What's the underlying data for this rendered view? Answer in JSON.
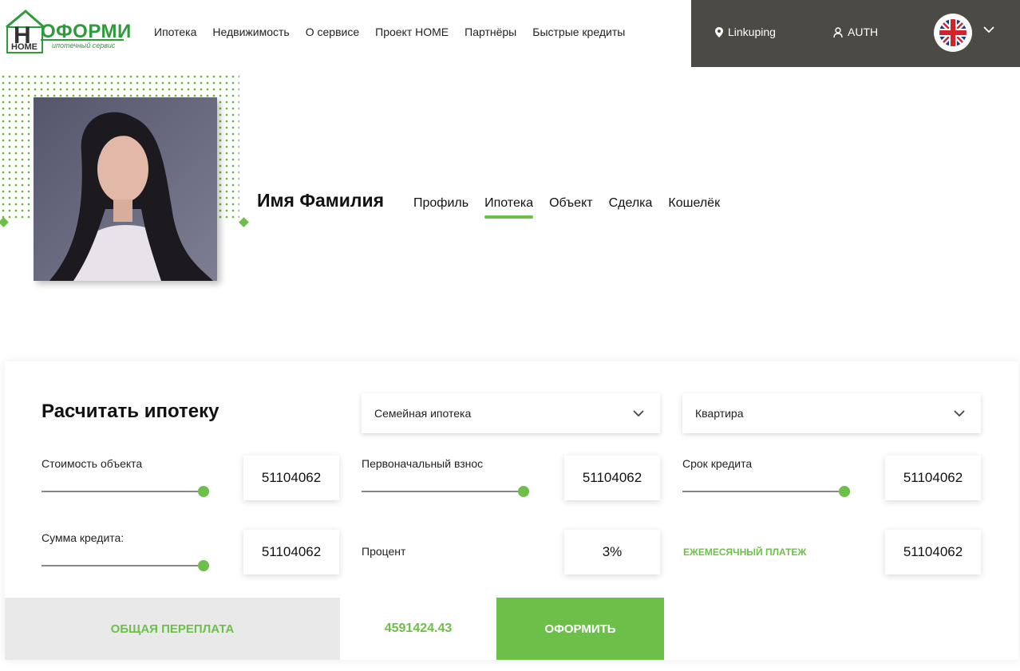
{
  "header": {
    "logo": {
      "letter": "H",
      "name": "ОФОРМИ",
      "home": "HOME",
      "tagline": "ипотечный сервис"
    },
    "nav": [
      "Ипотека",
      "Недвижимость",
      "О сервисе",
      "Проект HOME",
      "Партнёры",
      "Быстрые кредиты"
    ],
    "location": {
      "icon": "map-pin-icon",
      "label": "Linkuping"
    },
    "auth": {
      "icon": "user-icon",
      "label": "AUTH"
    },
    "language": {
      "icon": "uk-flag-icon"
    }
  },
  "profile": {
    "name": "Имя Фамилия",
    "tabs": [
      {
        "label": "Профиль",
        "active": false
      },
      {
        "label": "Ипотека",
        "active": true
      },
      {
        "label": "Объект",
        "active": false
      },
      {
        "label": "Сделка",
        "active": false
      },
      {
        "label": "Кошелёк",
        "active": false
      }
    ]
  },
  "calculator": {
    "title": "Расчитать ипотеку",
    "mortgage_type": "Семейная ипотека",
    "property_type": "Квартира",
    "fields": {
      "object_cost": {
        "label": "Стоимость объекта",
        "value": "51104062",
        "level": 1.0
      },
      "down_payment": {
        "label": "Первоначальный взнос",
        "value": "51104062",
        "level": 1.0
      },
      "loan_term": {
        "label": "Срок кредита",
        "value": "51104062",
        "level": 1.0
      },
      "loan_amount": {
        "label": "Сумма кредита:",
        "value": "51104062",
        "level": 1.0
      },
      "rate": {
        "label": "Процент",
        "value": "3%"
      },
      "monthly": {
        "label": "ЕЖЕМЕСЯЧНЫЙ ПЛАТЕЖ",
        "value": "51104062"
      }
    },
    "overpayment": {
      "label": "ОБЩАЯ ПЕРЕПЛАТА",
      "value": "4591424.43"
    },
    "submit_label": "ОФОРМИТЬ"
  },
  "colors": {
    "accent": "#6cc04a",
    "header_dark": "#4b4a45",
    "logo_green": "#2e9b3a"
  }
}
